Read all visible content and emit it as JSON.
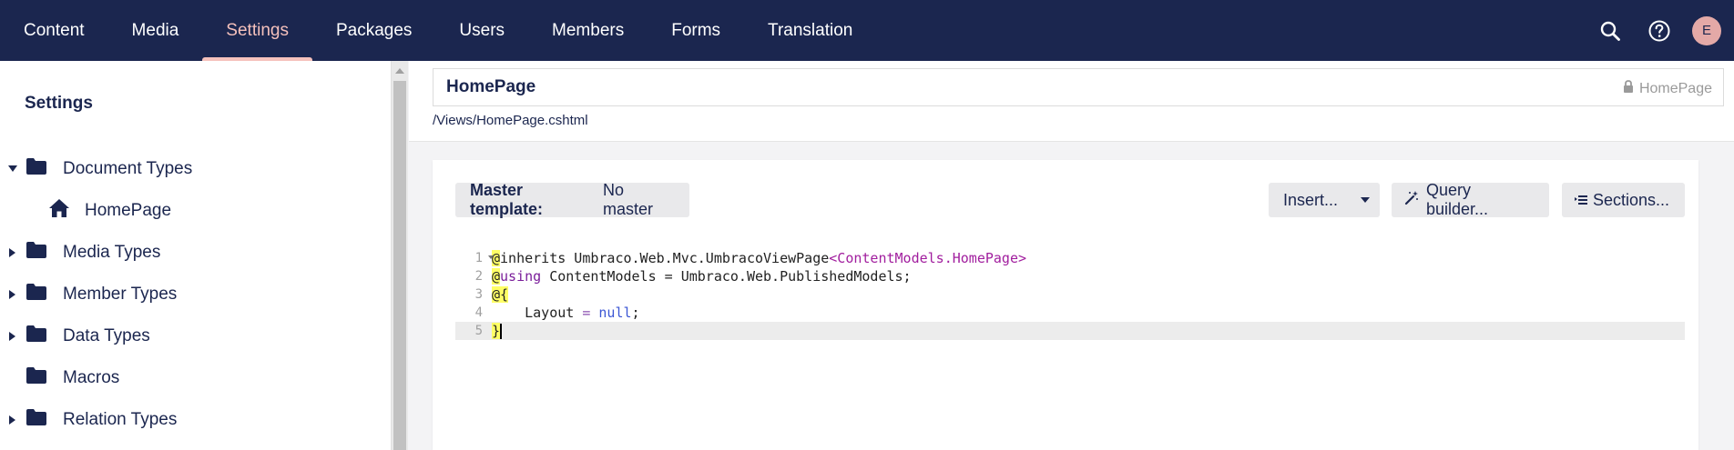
{
  "nav": {
    "items": [
      {
        "label": "Content",
        "active": false
      },
      {
        "label": "Media",
        "active": false
      },
      {
        "label": "Settings",
        "active": true
      },
      {
        "label": "Packages",
        "active": false
      },
      {
        "label": "Users",
        "active": false
      },
      {
        "label": "Members",
        "active": false
      },
      {
        "label": "Forms",
        "active": false
      },
      {
        "label": "Translation",
        "active": false
      }
    ],
    "avatar_initial": "E",
    "icons": [
      "search-icon",
      "help-icon"
    ]
  },
  "sidebar": {
    "title": "Settings",
    "tree": [
      {
        "label": "Document Types",
        "expanded": true,
        "icon": "folder-icon"
      },
      {
        "label": "HomePage",
        "child": true,
        "icon": "home-icon"
      },
      {
        "label": "Media Types",
        "expanded": false,
        "icon": "folder-icon"
      },
      {
        "label": "Member Types",
        "expanded": false,
        "icon": "folder-icon"
      },
      {
        "label": "Data Types",
        "expanded": false,
        "icon": "folder-icon"
      },
      {
        "label": "Macros",
        "expanded": null,
        "icon": "folder-icon"
      },
      {
        "label": "Relation Types",
        "expanded": false,
        "icon": "folder-icon"
      }
    ]
  },
  "editor": {
    "name": "HomePage",
    "alias": "HomePage",
    "path": "/Views/HomePage.cshtml",
    "master_label": "Master template:",
    "master_value": "No master",
    "insert_label": "Insert...",
    "query_label": "Query builder...",
    "sections_label": "Sections...",
    "code": {
      "line_numbers": [
        "1",
        "2",
        "3",
        "4",
        "5"
      ],
      "l1_a": "@",
      "l1_b": "inherits Umbraco.Web.Mvc.UmbracoViewPage",
      "l1_c": "<ContentModels.HomePage>",
      "l2_a": "@",
      "l2_b": "using",
      "l2_c": " ContentModels = Umbraco.Web.PublishedModels;",
      "l3_a": "@{",
      "l4_a": "    Layout ",
      "l4_b": "=",
      "l4_c": " ",
      "l4_d": "null",
      "l4_e": ";",
      "l5_a": "}"
    }
  }
}
